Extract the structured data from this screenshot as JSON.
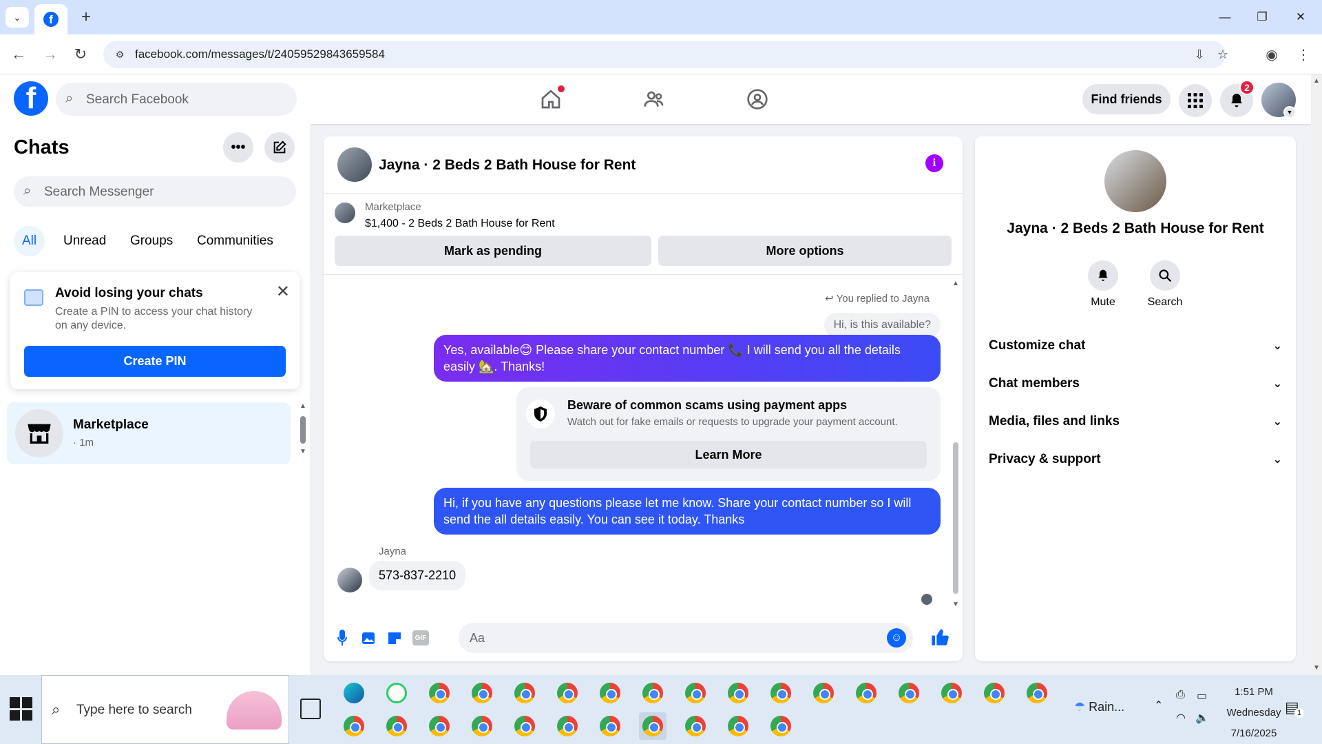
{
  "browser": {
    "url": "facebook.com/messages/t/24059529843659584",
    "window_controls": {
      "minimize": "—",
      "restore": "❐",
      "close": "✕"
    }
  },
  "header": {
    "search_placeholder": "Search Facebook",
    "find_friends": "Find friends",
    "notification_count": "2",
    "brand_color": "#0866ff"
  },
  "sidebar": {
    "title": "Chats",
    "search_placeholder": "Search Messenger",
    "filters": [
      "All",
      "Unread",
      "Groups",
      "Communities"
    ],
    "active_filter": "All",
    "pin_card": {
      "title": "Avoid losing your chats",
      "description": "Create a PIN to access your chat history on any device.",
      "button": "Create PIN"
    },
    "conversations": [
      {
        "name": "Marketplace",
        "time": "· 1m"
      }
    ]
  },
  "chat": {
    "title": "Jayna · 2 Beds 2 Bath House for Rent",
    "marketplace_label": "Marketplace",
    "listing": "$1,400 - 2 Beds 2 Bath House for Rent",
    "mark_pending": "Mark as pending",
    "more_options": "More options",
    "replied_label": "You replied to Jayna",
    "quoted_message": "Hi, is this available?",
    "outgoing_1": "Yes, available😊 Please share your contact number 📞 I will send you all the details easily 🏡. Thanks!",
    "scam_title": "Beware of common scams using payment apps",
    "scam_desc": "Watch out for fake emails or requests to upgrade your payment account.",
    "scam_button": "Learn More",
    "outgoing_2": "Hi, if you have any questions please let me know. Share your contact number so I will send the all details easily. You can see it today. Thanks",
    "sender_name": "Jayna",
    "incoming_1": "573-837-2210",
    "composer_placeholder": "Aa"
  },
  "info_panel": {
    "name": "Jayna · 2 Beds 2 Bath House for Rent",
    "actions": [
      "Mute",
      "Search"
    ],
    "sections": [
      "Customize chat",
      "Chat members",
      "Media, files and links",
      "Privacy & support"
    ]
  },
  "taskbar": {
    "search_placeholder": "Type here to search",
    "weather": "Rain...",
    "time": "1:51 PM",
    "day": "Wednesday",
    "date": "7/16/2025",
    "notification_count": "1"
  }
}
